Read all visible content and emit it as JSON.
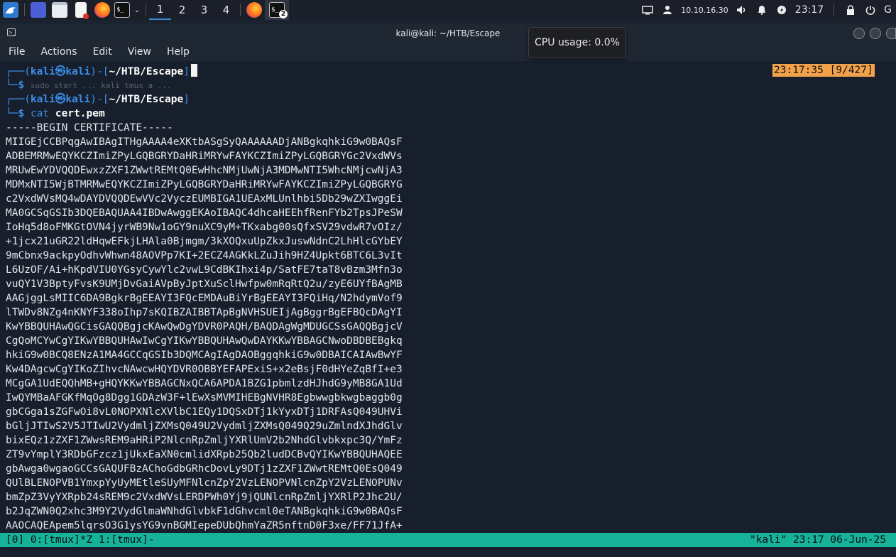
{
  "panel": {
    "workspaces": [
      "1",
      "2",
      "3",
      "4"
    ],
    "ip": "10.10.16.30",
    "time": "23:17",
    "badge": "2",
    "trailing": "G"
  },
  "window": {
    "title": "kali@kali: ~/HTB/Escape",
    "menus": [
      "File",
      "Actions",
      "Edit",
      "View",
      "Help"
    ]
  },
  "tooltip": "CPU usage: 0.0%",
  "terminal": {
    "prompt1": {
      "open": "┌──(",
      "user": "kali㉿kali",
      "mid": ")-[",
      "path": "~/HTB/Escape",
      "close": "]"
    },
    "prompt1_line2": "└─",
    "dollar": "$",
    "ghost": "sudo start ... kali tmux a ...",
    "prompt2": {
      "open": "┌──(",
      "user": "kali㉿kali",
      "mid": ")-[",
      "path": "~/HTB/Escape",
      "close": "]"
    },
    "cmd": "cat",
    "cmd_arg": "cert.pem",
    "clock": "23:17:35 [9/427]",
    "cert_begin": "-----BEGIN CERTIFICATE-----",
    "cert_lines": [
      "MIIGEjCCBPqgAwIBAgITHgAAAA4eXKtbASgSyQAAAAAADjANBgkqhkiG9w0BAQsF",
      "ADBEMRMwEQYKCZImiZPyLGQBGRYDaHRiMRYwFAYKCZImiZPyLGQBGRYGc2VxdWVs",
      "MRUwEwYDVQQDEwxzZXF1ZWwtREMtQ0EwHhcNMjUwNjA3MDMwNTI5WhcNMjcwNjA3",
      "MDMxNTI5WjBTMRMwEQYKCZImiZPyLGQBGRYDaHRiMRYwFAYKCZImiZPyLGQBGRYG",
      "c2VxdWVsMQ4wDAYDVQQDEwVVc2VyczEUMBIGA1UEAxMLUnlhbi5Db29wZXIwggEi",
      "MA0GCSqGSIb3DQEBAQUAA4IBDwAwggEKAoIBAQC4dhcaHEEhfRenFYb2TpsJPeSW",
      "IoHq5d8oFMKGtOVN4jyrWB9Nw1oGY9nuXC9yM+TKxabg00sQfxSV29vdwR7vOIz/",
      "+1jcx21uGR22ldHqwEFkjLHAla0Bjmgm/3kXOQxuUpZkxJuswNdnC2LhHlcGYbEY",
      "9mCbnx9ackpyOdhvWhwn48AOVPp7KI+2ECZ4AGKkLZuJih9HZ4Upkt6BTC6L3vIt",
      "L6UzOF/Ai+hKpdVIU0YGsyCywYlc2vwL9CdBKIhxi4p/SatFE7taT8vBzm3Mfn3o",
      "vuQY1V3BptyFvsK9UMjDvGaiAVpByJptXuSclHwfpw0mRqRtQ2u/zyE6UYfBAgMB",
      "AAGjggLsMIIC6DA9BgkrBgEEAYI3FQcEMDAuBiYrBgEEAYI3FQiHq/N2hdymVof9",
      "lTWDv8NZg4nKNYF338oIhp7sKQIBZAIBBTApBgNVHSUEIjAgBggrBgEFBQcDAgYI",
      "KwYBBQUHAwQGCisGAQQBgjcKAwQwDgYDVR0PAQH/BAQDAgWgMDUGCSsGAQQBgjcV",
      "CgQoMCYwCgYIKwYBBQUHAwIwCgYIKwYBBQUHAwQwDAYKKwYBBAGCNwoDBDBEBgkq",
      "hkiG9w0BCQ8ENzA1MA4GCCqGSIb3DQMCAgIAgDAOBggqhkiG9w0DBAICAIAwBwYF",
      "Kw4DAgcwCgYIKoZIhvcNAwcwHQYDVR0OBBYEFAPExiS+x2eBsjF0dHYeZqBfI+e3",
      "MCgGA1UdEQQhMB+gHQYKKwYBBAGCNxQCA6APDA1BZG1pbmlzdHJhdG9yMB8GA1Ud",
      "IwQYMBaAFGKfMqOg8Dgg1GDAzW3F+lEwXsMVMIHEBgNVHR8Egbwwgbkwgbaggb0g",
      "gbCGga1sZGFwOi8vL0NOPXNlcXVlbC1EQy1DQSxDTj1kYyxDTj1DRFAsQ049UHVi",
      "bGljJTIwS2V5JTIwU2VydmljZXMsQ049U2VydmljZXMsQ049Q29uZmlndXJhdGlv",
      "bixEQz1zZXF1ZWwsREM9aHRiP2NlcnRpZmljYXRlUmV2b2NhdGlvbkxpc3Q/YmFz",
      "ZT9vYmplY3RDbGFzcz1jUkxEaXN0cmlidXRpb25Qb2ludDCBvQYIKwYBBQUHAQEE",
      "gbAwga0wgaoGCCsGAQUFBzAChoGdbGRhcDovLy9DTj1zZXF1ZWwtREMtQ0EsQ049",
      "QUlBLENOPVB1YmxpYyUyMEtleSUyMFNlcnZpY2VzLENOPVNlcnZpY2VzLENOPUNv",
      "bmZpZ3VyYXRpb24sREM9c2VxdWVsLERDPWh0Yj9jQUNlcnRpZmljYXRlP2Jhc2U/",
      "b2JqZWN0Q2xhc3M9Y2VydGlmaWNhdGlvbkF1dGhvcml0eTANBgkqhkiG9w0BAQsF",
      "AAOCAQEApem5lqrsO3G1ysYG9vnBGMIepeDUbQhmYaZR5nftnD0F3xe/FF71JfA+"
    ]
  },
  "tmux": {
    "left": "[0] 0:[tmux]*Z 1:[tmux]-",
    "right": "\"kali\" 23:17 06-Jun-25"
  },
  "colors": {
    "prompt_blue": "#3b8ee8",
    "tmux_green": "#17b29a",
    "clock_orange": "#f2a24a",
    "panel_bg": "#1a1f29"
  }
}
